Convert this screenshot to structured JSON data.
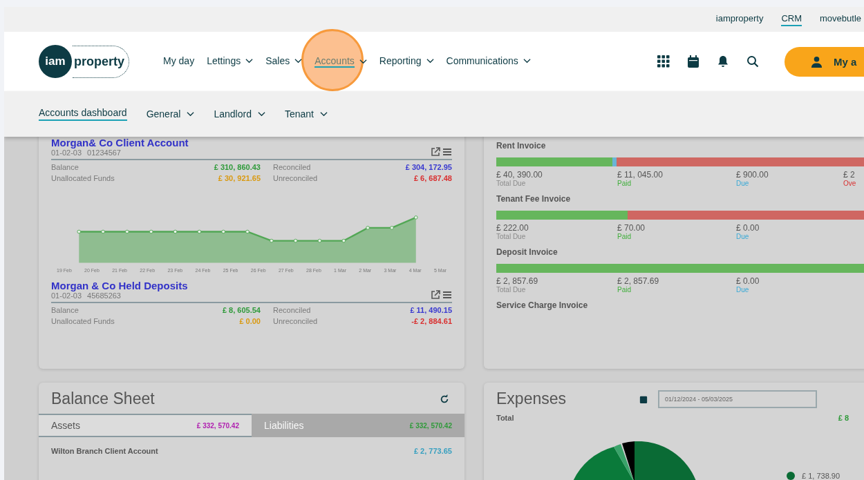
{
  "top_links": [
    {
      "label": "iamproperty",
      "selected": false
    },
    {
      "label": "CRM",
      "selected": true
    },
    {
      "label": "movebutle",
      "selected": false
    }
  ],
  "logo": {
    "badge": "iam",
    "word": "property"
  },
  "nav": [
    {
      "label": "My day",
      "dropdown": false,
      "selected": false,
      "highlighted": false
    },
    {
      "label": "Lettings",
      "dropdown": true,
      "selected": false,
      "highlighted": false
    },
    {
      "label": "Sales",
      "dropdown": true,
      "selected": false,
      "highlighted": false
    },
    {
      "label": "Accounts",
      "dropdown": true,
      "selected": true,
      "highlighted": true
    },
    {
      "label": "Reporting",
      "dropdown": true,
      "selected": false,
      "highlighted": false
    },
    {
      "label": "Communications",
      "dropdown": true,
      "selected": false,
      "highlighted": false
    }
  ],
  "account_button": {
    "label": "My a"
  },
  "subnav": [
    {
      "label": "Accounts dashboard",
      "dropdown": false,
      "selected": true
    },
    {
      "label": "General",
      "dropdown": true,
      "selected": false
    },
    {
      "label": "Landlord",
      "dropdown": true,
      "selected": false
    },
    {
      "label": "Tenant",
      "dropdown": true,
      "selected": false
    }
  ],
  "bank_accounts": [
    {
      "name": "Morgan& Co Client Account",
      "sort_code": "01-02-03",
      "number": "01234567",
      "balance": {
        "label": "Balance",
        "value": "£ 310, 860.43"
      },
      "unallocated": {
        "label": "Unallocated Funds",
        "value": "£ 30, 921.65"
      },
      "reconciled": {
        "label": "Reconciled",
        "value": "£ 304, 172.95"
      },
      "unreconciled": {
        "label": "Unreconciled",
        "value": "£ 6, 687.48"
      },
      "chart_labels": [
        "19 Feb",
        "20 Feb",
        "21 Feb",
        "22 Feb",
        "23 Feb",
        "24 Feb",
        "25 Feb",
        "26 Feb",
        "27 Feb",
        "28 Feb",
        "1 Mar",
        "2 Mar",
        "3 Mar",
        "4 Mar",
        "5 Mar"
      ]
    },
    {
      "name": "Morgan & Co Held Deposits",
      "sort_code": "01-02-03",
      "number": "45685263",
      "balance": {
        "label": "Balance",
        "value": "£ 8, 605.54"
      },
      "unallocated": {
        "label": "Unallocated Funds",
        "value": "£ 0.00"
      },
      "reconciled": {
        "label": "Reconciled",
        "value": "£ 11, 490.15"
      },
      "unreconciled": {
        "label": "Unreconciled",
        "value": "-£ 2, 884.61"
      }
    }
  ],
  "invoices": [
    {
      "title": "Rent Invoice",
      "segments": [
        {
          "kind": "paid",
          "level": 0.3
        },
        {
          "kind": "due",
          "level": 0.01
        },
        {
          "kind": "overdue",
          "level": 0.69
        }
      ],
      "amounts": [
        {
          "kind": "total",
          "value": "£ 40, 390.00",
          "label": "Total Due"
        },
        {
          "kind": "paid",
          "value": "£ 11, 045.00",
          "label": "Paid"
        },
        {
          "kind": "due",
          "value": "£ 900.00",
          "label": "Due"
        },
        {
          "kind": "overdue",
          "value": "£ 2",
          "label": "Ove"
        }
      ]
    },
    {
      "title": "Tenant Fee Invoice",
      "segments": [
        {
          "kind": "paid",
          "level": 0.34
        },
        {
          "kind": "overdue",
          "level": 0.66
        }
      ],
      "amounts": [
        {
          "kind": "total",
          "value": "£ 222.00",
          "label": "Total Due"
        },
        {
          "kind": "paid",
          "value": "£ 70.00",
          "label": "Paid"
        },
        {
          "kind": "due",
          "value": "£ 0.00",
          "label": "Due"
        }
      ]
    },
    {
      "title": "Deposit Invoice",
      "segments": [
        {
          "kind": "paid",
          "level": 1
        }
      ],
      "amounts": [
        {
          "kind": "total",
          "value": "£ 2, 857.69",
          "label": "Total Due"
        },
        {
          "kind": "paid",
          "value": "£ 2, 857.69",
          "label": "Paid"
        },
        {
          "kind": "due",
          "value": "£ 0.00",
          "label": "Due"
        }
      ]
    },
    {
      "title": "Service Charge Invoice"
    }
  ],
  "balance_sheet": {
    "title": "Balance Sheet",
    "tabs": [
      {
        "label": "Assets",
        "amount": "£ 332, 570.42",
        "selected": true
      },
      {
        "label": "Liabilities",
        "amount": "£ 332, 570.42",
        "selected": false
      }
    ],
    "rows": [
      {
        "name": "Wilton Branch Client Account",
        "amount": "£ 2, 773.65"
      }
    ]
  },
  "expenses": {
    "title": "Expenses",
    "date_range": "01/12/2024 - 05/03/2025",
    "total_label": "Total",
    "total_value": "£ 8",
    "legend": [
      {
        "value": "£ 1, 738.90",
        "color": "#0a6b35"
      }
    ]
  }
}
